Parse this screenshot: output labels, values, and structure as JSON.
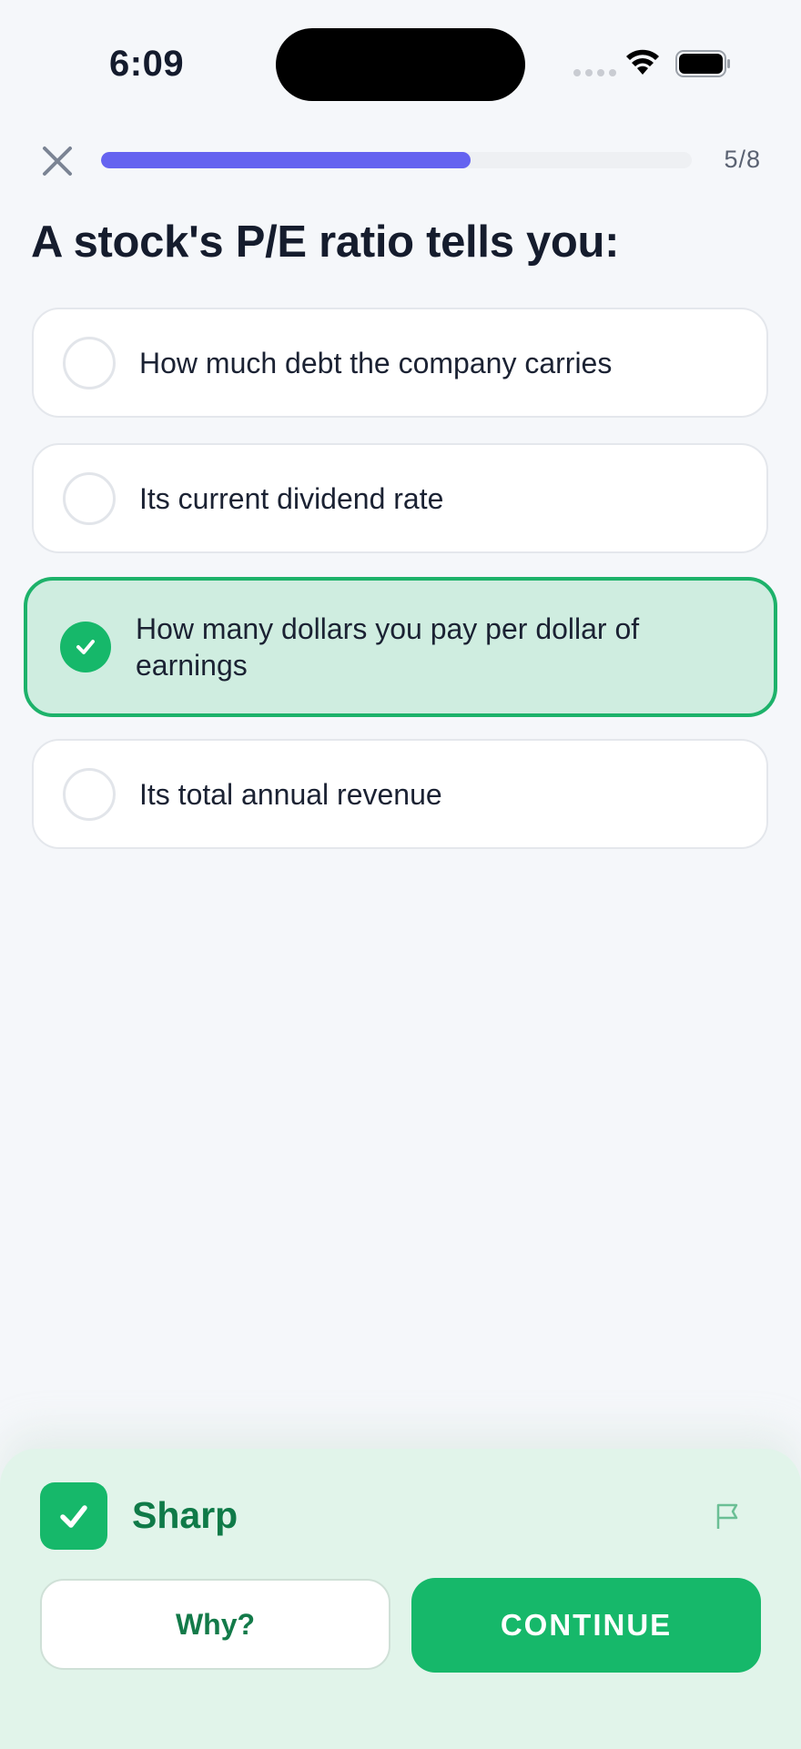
{
  "status_bar": {
    "time": "6:09"
  },
  "header": {
    "close_icon": "close-icon",
    "progress": {
      "current": 5,
      "total": 8,
      "fraction": 0.625
    },
    "progress_label": "5/8"
  },
  "question": "A stock's P/E ratio tells you:",
  "options": [
    {
      "label": "How much debt the company carries",
      "selected": false
    },
    {
      "label": "Its current dividend rate",
      "selected": false
    },
    {
      "label": "How many dollars you pay per dollar of earnings",
      "selected": true
    },
    {
      "label": "Its total annual revenue",
      "selected": false
    }
  ],
  "feedback": {
    "verdict": "Sharp",
    "verdict_icon": "checkmark-icon",
    "flag_icon": "flag-icon",
    "why_label": "Why?",
    "continue_label": "CONTINUE"
  },
  "colors": {
    "accent": "#6563f0",
    "success": "#16b86a",
    "success_text": "#0f7a48",
    "background": "#f5f7fa",
    "sheet": "#e1f4ea"
  }
}
